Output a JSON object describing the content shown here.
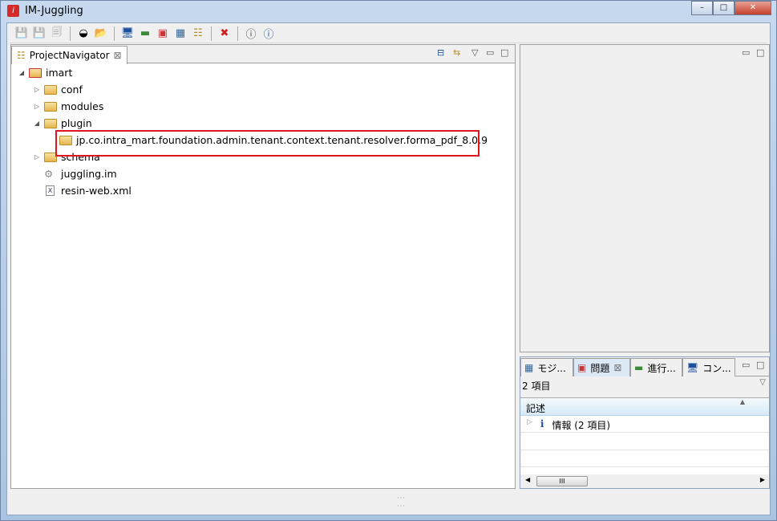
{
  "window": {
    "title": "IM-Juggling",
    "minimize": "–",
    "maximize": "□",
    "close": "✕"
  },
  "toolbar": {
    "icons": [
      "save-icon",
      "save-as-icon",
      "save-all-icon",
      "dashboard-icon",
      "open-folder-icon",
      "monitor-icon",
      "run-icon",
      "problems-icon",
      "modules-icon",
      "navigator-icon",
      "settings-icon",
      "help-icon",
      "info-icon"
    ]
  },
  "navigator": {
    "tab_label": "ProjectNavigator",
    "close": "⊠",
    "tree": [
      {
        "label": "imart",
        "level": 0,
        "arrow": "◢",
        "type": "project"
      },
      {
        "label": "conf",
        "level": 1,
        "arrow": "▷",
        "type": "folder"
      },
      {
        "label": "modules",
        "level": 1,
        "arrow": "▷",
        "type": "folder"
      },
      {
        "label": "plugin",
        "level": 1,
        "arrow": "◢",
        "type": "folder"
      },
      {
        "label": "jp.co.intra_mart.foundation.admin.tenant.context.tenant.resolver.forma_pdf_8.0.9",
        "level": 2,
        "arrow": "",
        "type": "folder"
      },
      {
        "label": "schema",
        "level": 1,
        "arrow": "▷",
        "type": "folder"
      },
      {
        "label": "juggling.im",
        "level": 1,
        "arrow": "",
        "type": "gear"
      },
      {
        "label": "resin-web.xml",
        "level": 1,
        "arrow": "",
        "type": "xml"
      }
    ]
  },
  "bottom": {
    "tabs": [
      "モジ...",
      "問題",
      "進行...",
      "コン..."
    ],
    "active": 1,
    "count": "2 項目",
    "column": "記述",
    "row_label": "情報 (2 項目)",
    "scroll_thumb": "III"
  }
}
